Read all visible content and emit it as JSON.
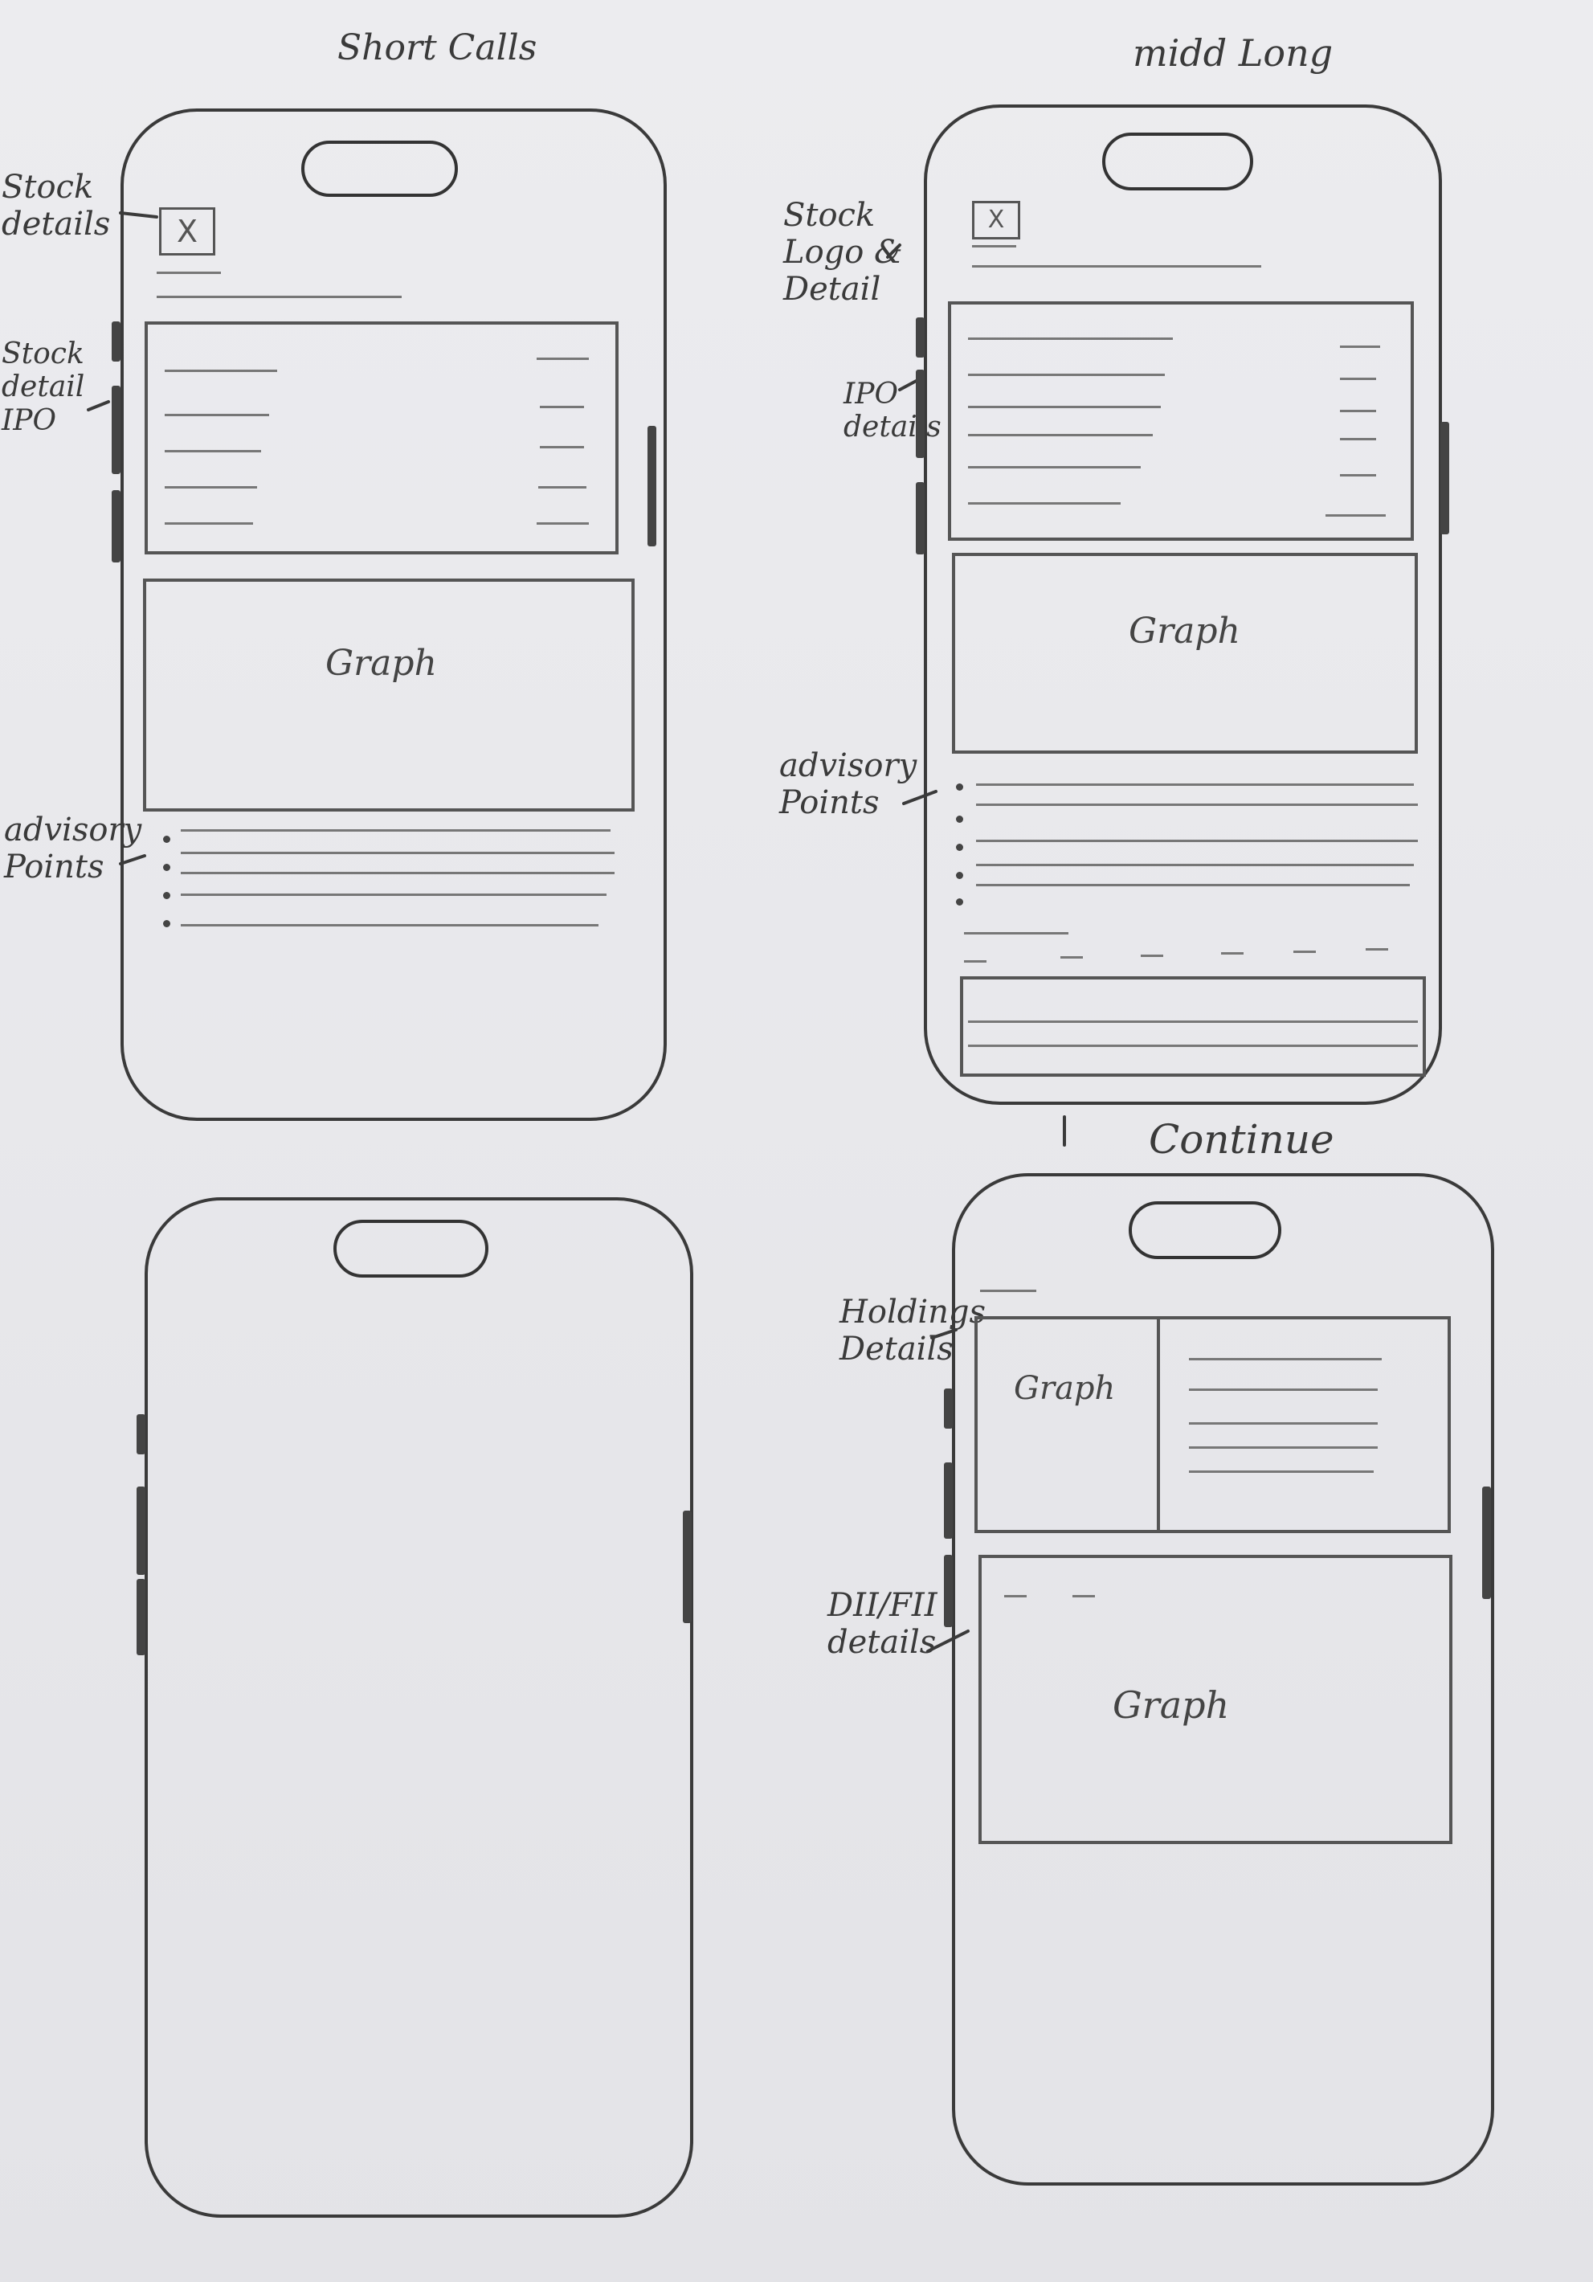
{
  "titles": {
    "short_calls": "Short Calls",
    "mid_long": "midd Long",
    "continue": "Continue"
  },
  "annotations": {
    "stock_details": "Stock\ndetails",
    "stock_detail_ipo": "Stock\ndetail\nIPO",
    "advisory_points_1": "advisory\nPoints",
    "stock_logo_detail": "Stock\nLogo &\nDetail",
    "ipo_details": "IPO\ndetails",
    "advisory_points_2": "advisory\nPoints",
    "holdings_details": "Holdings\nDetails",
    "dii_fii_details": "DII/FII\ndetails"
  },
  "graph_labels": {
    "phone1": "Graph",
    "phone2": "Graph",
    "phone4_holdings": "Graph",
    "phone4_dii": "Graph"
  },
  "logo_glyph": "X",
  "colors": {
    "ink": "#3a3a3a",
    "paper": "#e6e6ea"
  }
}
